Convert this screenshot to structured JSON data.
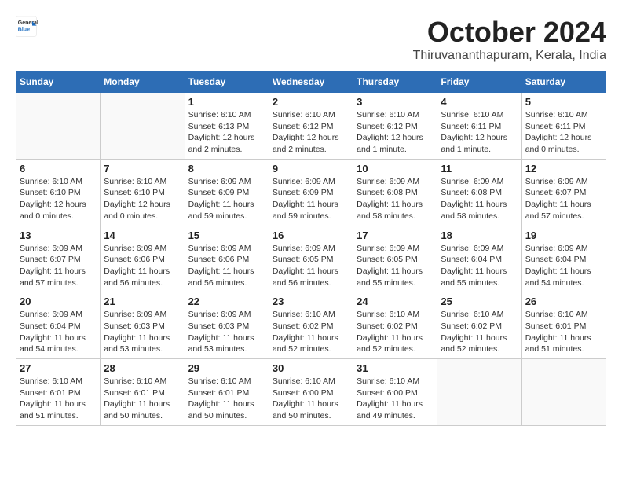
{
  "logo": {
    "general": "General",
    "blue": "Blue"
  },
  "header": {
    "month": "October 2024",
    "location": "Thiruvananthapuram, Kerala, India"
  },
  "weekdays": [
    "Sunday",
    "Monday",
    "Tuesday",
    "Wednesday",
    "Thursday",
    "Friday",
    "Saturday"
  ],
  "weeks": [
    [
      {
        "day": "",
        "info": ""
      },
      {
        "day": "",
        "info": ""
      },
      {
        "day": "1",
        "info": "Sunrise: 6:10 AM\nSunset: 6:13 PM\nDaylight: 12 hours\nand 2 minutes."
      },
      {
        "day": "2",
        "info": "Sunrise: 6:10 AM\nSunset: 6:12 PM\nDaylight: 12 hours\nand 2 minutes."
      },
      {
        "day": "3",
        "info": "Sunrise: 6:10 AM\nSunset: 6:12 PM\nDaylight: 12 hours\nand 1 minute."
      },
      {
        "day": "4",
        "info": "Sunrise: 6:10 AM\nSunset: 6:11 PM\nDaylight: 12 hours\nand 1 minute."
      },
      {
        "day": "5",
        "info": "Sunrise: 6:10 AM\nSunset: 6:11 PM\nDaylight: 12 hours\nand 0 minutes."
      }
    ],
    [
      {
        "day": "6",
        "info": "Sunrise: 6:10 AM\nSunset: 6:10 PM\nDaylight: 12 hours\nand 0 minutes."
      },
      {
        "day": "7",
        "info": "Sunrise: 6:10 AM\nSunset: 6:10 PM\nDaylight: 12 hours\nand 0 minutes."
      },
      {
        "day": "8",
        "info": "Sunrise: 6:09 AM\nSunset: 6:09 PM\nDaylight: 11 hours\nand 59 minutes."
      },
      {
        "day": "9",
        "info": "Sunrise: 6:09 AM\nSunset: 6:09 PM\nDaylight: 11 hours\nand 59 minutes."
      },
      {
        "day": "10",
        "info": "Sunrise: 6:09 AM\nSunset: 6:08 PM\nDaylight: 11 hours\nand 58 minutes."
      },
      {
        "day": "11",
        "info": "Sunrise: 6:09 AM\nSunset: 6:08 PM\nDaylight: 11 hours\nand 58 minutes."
      },
      {
        "day": "12",
        "info": "Sunrise: 6:09 AM\nSunset: 6:07 PM\nDaylight: 11 hours\nand 57 minutes."
      }
    ],
    [
      {
        "day": "13",
        "info": "Sunrise: 6:09 AM\nSunset: 6:07 PM\nDaylight: 11 hours\nand 57 minutes."
      },
      {
        "day": "14",
        "info": "Sunrise: 6:09 AM\nSunset: 6:06 PM\nDaylight: 11 hours\nand 56 minutes."
      },
      {
        "day": "15",
        "info": "Sunrise: 6:09 AM\nSunset: 6:06 PM\nDaylight: 11 hours\nand 56 minutes."
      },
      {
        "day": "16",
        "info": "Sunrise: 6:09 AM\nSunset: 6:05 PM\nDaylight: 11 hours\nand 56 minutes."
      },
      {
        "day": "17",
        "info": "Sunrise: 6:09 AM\nSunset: 6:05 PM\nDaylight: 11 hours\nand 55 minutes."
      },
      {
        "day": "18",
        "info": "Sunrise: 6:09 AM\nSunset: 6:04 PM\nDaylight: 11 hours\nand 55 minutes."
      },
      {
        "day": "19",
        "info": "Sunrise: 6:09 AM\nSunset: 6:04 PM\nDaylight: 11 hours\nand 54 minutes."
      }
    ],
    [
      {
        "day": "20",
        "info": "Sunrise: 6:09 AM\nSunset: 6:04 PM\nDaylight: 11 hours\nand 54 minutes."
      },
      {
        "day": "21",
        "info": "Sunrise: 6:09 AM\nSunset: 6:03 PM\nDaylight: 11 hours\nand 53 minutes."
      },
      {
        "day": "22",
        "info": "Sunrise: 6:09 AM\nSunset: 6:03 PM\nDaylight: 11 hours\nand 53 minutes."
      },
      {
        "day": "23",
        "info": "Sunrise: 6:10 AM\nSunset: 6:02 PM\nDaylight: 11 hours\nand 52 minutes."
      },
      {
        "day": "24",
        "info": "Sunrise: 6:10 AM\nSunset: 6:02 PM\nDaylight: 11 hours\nand 52 minutes."
      },
      {
        "day": "25",
        "info": "Sunrise: 6:10 AM\nSunset: 6:02 PM\nDaylight: 11 hours\nand 52 minutes."
      },
      {
        "day": "26",
        "info": "Sunrise: 6:10 AM\nSunset: 6:01 PM\nDaylight: 11 hours\nand 51 minutes."
      }
    ],
    [
      {
        "day": "27",
        "info": "Sunrise: 6:10 AM\nSunset: 6:01 PM\nDaylight: 11 hours\nand 51 minutes."
      },
      {
        "day": "28",
        "info": "Sunrise: 6:10 AM\nSunset: 6:01 PM\nDaylight: 11 hours\nand 50 minutes."
      },
      {
        "day": "29",
        "info": "Sunrise: 6:10 AM\nSunset: 6:01 PM\nDaylight: 11 hours\nand 50 minutes."
      },
      {
        "day": "30",
        "info": "Sunrise: 6:10 AM\nSunset: 6:00 PM\nDaylight: 11 hours\nand 50 minutes."
      },
      {
        "day": "31",
        "info": "Sunrise: 6:10 AM\nSunset: 6:00 PM\nDaylight: 11 hours\nand 49 minutes."
      },
      {
        "day": "",
        "info": ""
      },
      {
        "day": "",
        "info": ""
      }
    ]
  ]
}
